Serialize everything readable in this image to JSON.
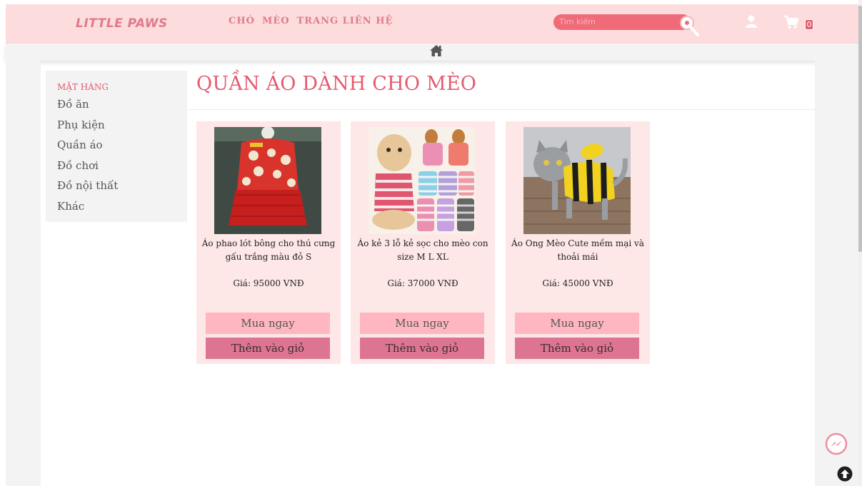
{
  "header": {
    "logo": "LITTLE PAWS",
    "nav": [
      "CHÓ",
      "MÈO",
      "TRANG LIÊN HỆ"
    ],
    "search_placeholder": "Tìm kiếm",
    "cart_count": "0"
  },
  "sidebar": {
    "title": "MẶT HÀNG",
    "items": [
      "Đồ ăn",
      "Phụ kiện",
      "Quần áo",
      "Đồ chơi",
      "Đồ nội thất",
      "Khác"
    ]
  },
  "main": {
    "title": "QUẦN ÁO DÀNH CHO MÈO",
    "products": [
      {
        "name": "Áo phao lót bông cho thú cưng gấu trắng màu đỏ S",
        "price": "Giá: 95000 VNĐ",
        "buy_label": "Mua ngay",
        "cart_label": "Thêm vào giỏ"
      },
      {
        "name": "Áo kẻ 3 lỗ kẻ sọc cho mèo con size M L XL",
        "price": "Giá: 37000 VNĐ",
        "buy_label": "Mua ngay",
        "cart_label": "Thêm vào giỏ"
      },
      {
        "name": "Áo Ong Mèo Cute mềm mại và thoải mái",
        "price": "Giá: 45000 VNĐ",
        "buy_label": "Mua ngay",
        "cart_label": "Thêm vào giỏ"
      }
    ]
  },
  "colors": {
    "header_bg": "#fcdcdc",
    "accent": "#e05a6b",
    "card_bg": "#fde7e7",
    "buy_button": "#ffb6c1",
    "cart_button": "#dd7592"
  },
  "icons": [
    "search-icon",
    "user-icon",
    "cart-icon",
    "home-icon",
    "messenger-icon",
    "scroll-top-icon"
  ]
}
